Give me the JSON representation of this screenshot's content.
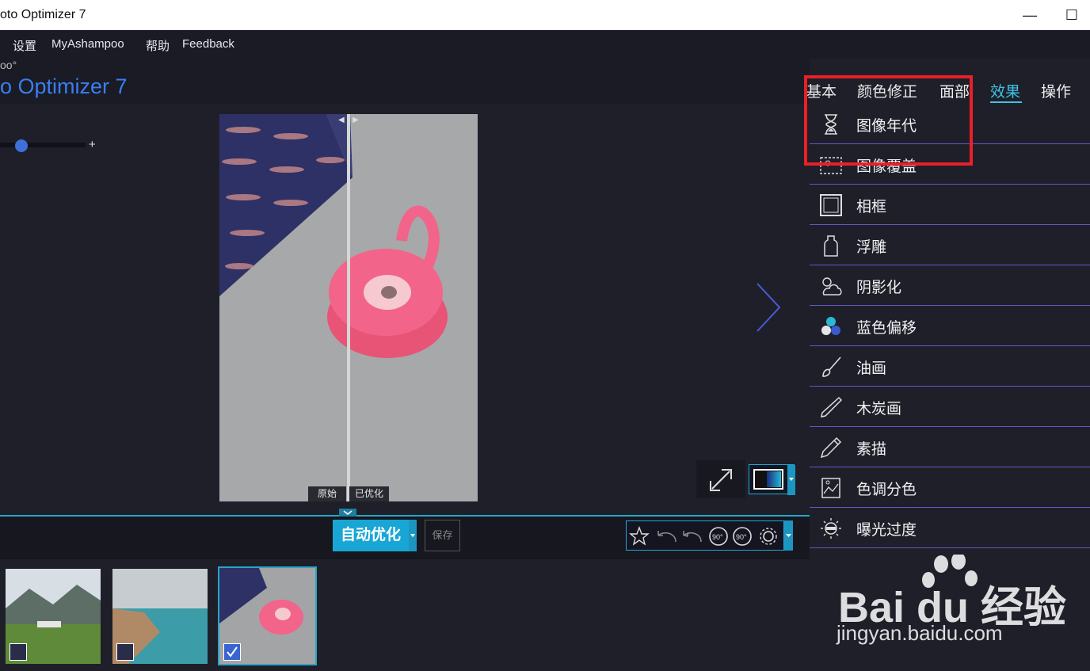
{
  "window": {
    "title": "oto Optimizer 7"
  },
  "menu": {
    "items": [
      "设置",
      "MyAshampoo",
      "帮助",
      "Feedback"
    ]
  },
  "brand": {
    "small": "oo°",
    "name": "o Optimizer 7"
  },
  "preview": {
    "original_label": "原始",
    "optimized_label": "已优化"
  },
  "actions": {
    "auto_optimize": "自动优化",
    "save": "保存"
  },
  "tabs": [
    {
      "label": "基本",
      "active": false
    },
    {
      "label": "颜色修正",
      "active": false
    },
    {
      "label": "面部",
      "active": false
    },
    {
      "label": "效果",
      "active": true
    },
    {
      "label": "操作",
      "active": false
    }
  ],
  "effects": [
    {
      "label": "图像年代",
      "icon": "hourglass-icon"
    },
    {
      "label": "图像覆盖",
      "icon": "image-overlay-icon"
    },
    {
      "label": "相框",
      "icon": "frame-icon"
    },
    {
      "label": "浮雕",
      "icon": "emboss-icon"
    },
    {
      "label": "阴影化",
      "icon": "shadow-cloud-icon"
    },
    {
      "label": "蓝色偏移",
      "icon": "blue-shift-icon"
    },
    {
      "label": "油画",
      "icon": "brush-icon"
    },
    {
      "label": "木炭画",
      "icon": "charcoal-icon"
    },
    {
      "label": "素描",
      "icon": "pencil-icon"
    },
    {
      "label": "色调分色",
      "icon": "posterize-icon"
    },
    {
      "label": "曝光过度",
      "icon": "overexposure-icon"
    }
  ],
  "watermark": {
    "brand": "Bai du 经验",
    "url": "jingyan.baidu.com"
  },
  "colors": {
    "accent": "#3cc3e4",
    "highlight": "#e8202a",
    "divider": "#6357c9",
    "button": "#1aa6d4"
  }
}
